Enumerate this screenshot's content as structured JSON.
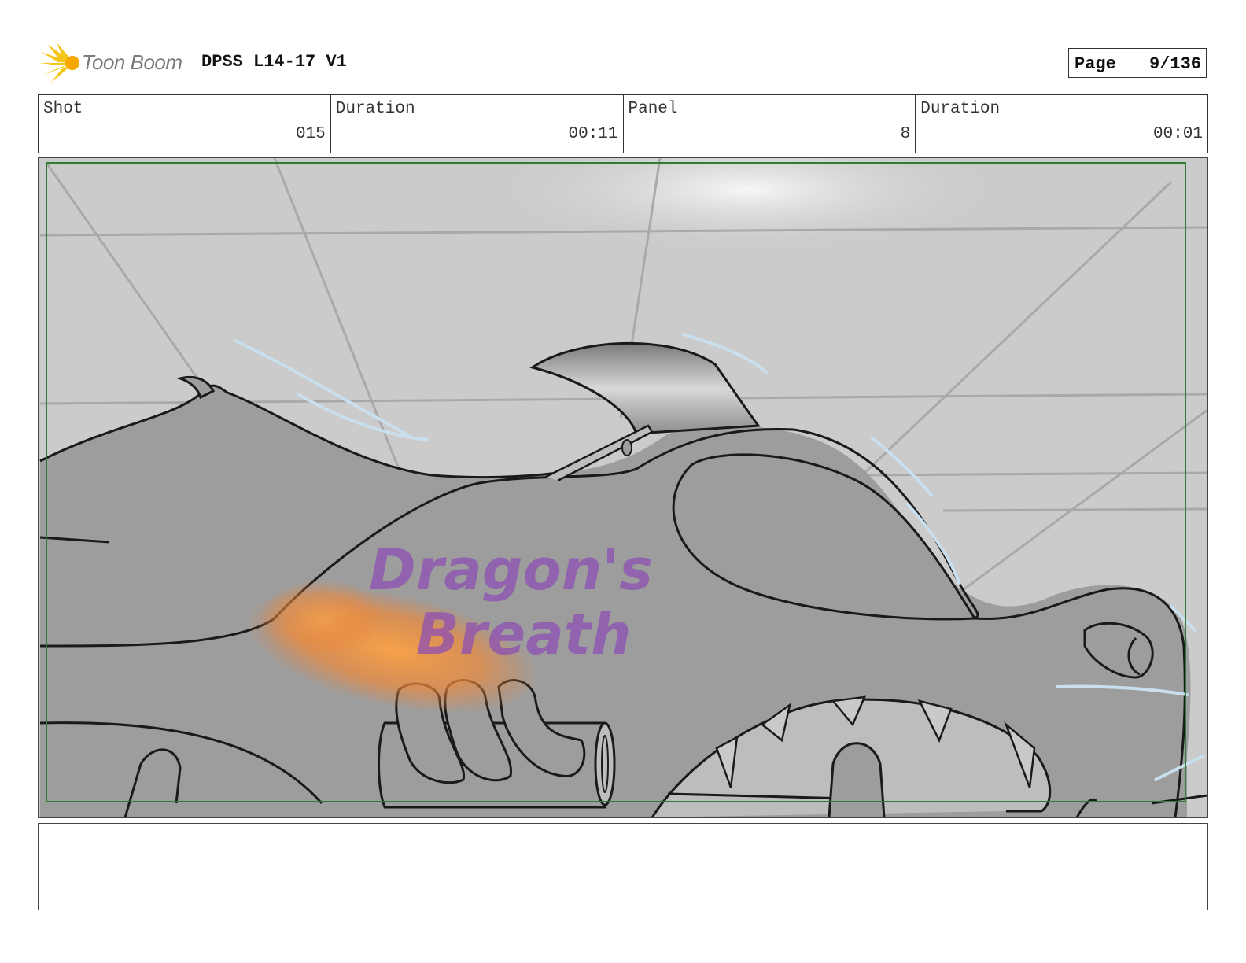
{
  "header": {
    "logo_text": "Toon Boom",
    "project_title": "DPSS L14-17 V1",
    "page_label": "Page",
    "page_value": "9/136"
  },
  "info": {
    "shot_label": "Shot",
    "shot_value": "015",
    "shot_duration_label": "Duration",
    "shot_duration_value": "00:11",
    "panel_label": "Panel",
    "panel_value": "8",
    "panel_duration_label": "Duration",
    "panel_duration_value": "00:01"
  },
  "panel": {
    "sketch_text_line1": "Dragon's",
    "sketch_text_line2": "Breath"
  },
  "notes": "",
  "colors": {
    "safe_frame": "#2e7d32",
    "logo_yellow": "#f5c518",
    "sketch_purple": "#8e4fb3",
    "flame_orange": "#f08a24",
    "speed_lines": "#c9dfee"
  }
}
